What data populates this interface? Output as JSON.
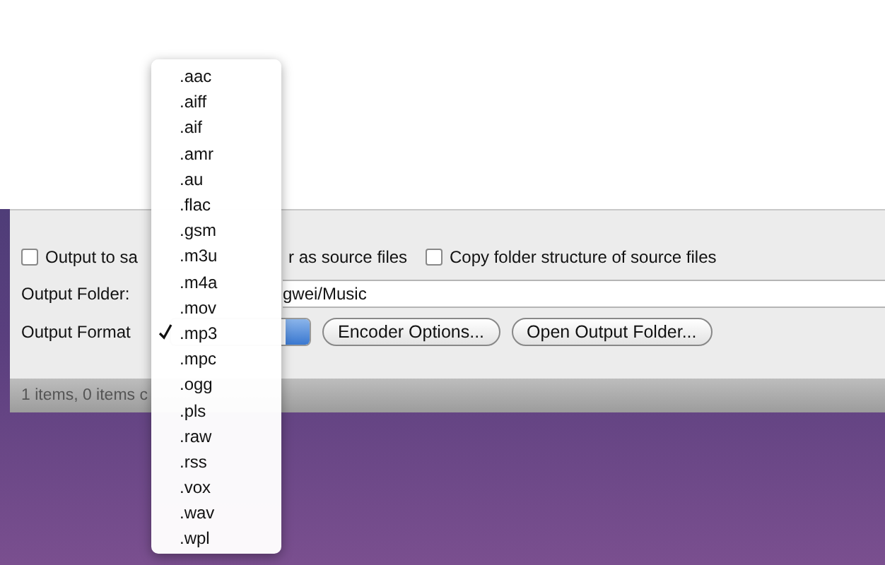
{
  "options": [
    {
      "kind": "checkbox",
      "checked": false,
      "label_parts": [
        "Output to sa",
        "r as source files"
      ]
    },
    {
      "kind": "checkbox",
      "checked": false,
      "label_parts": [
        "Copy folder structure of source files"
      ]
    }
  ],
  "output_folder": {
    "label": "Output Folder:",
    "value": "gwei/Music"
  },
  "output_format": {
    "label": "Output Format"
  },
  "buttons": [
    "Encoder Options...",
    "Open Output Folder..."
  ],
  "status_bar": "1 items, 0 items c",
  "format_menu": {
    "items": [
      {
        "label": ".aac",
        "selected": false
      },
      {
        "label": ".aiff",
        "selected": false
      },
      {
        "label": ".aif",
        "selected": false
      },
      {
        "label": ".amr",
        "selected": false
      },
      {
        "label": ".au",
        "selected": false
      },
      {
        "label": ".flac",
        "selected": false
      },
      {
        "label": ".gsm",
        "selected": false
      },
      {
        "label": ".m3u",
        "selected": false
      },
      {
        "label": ".m4a",
        "selected": false
      },
      {
        "label": ".mov",
        "selected": false
      },
      {
        "label": ".mp3",
        "selected": true
      },
      {
        "label": ".mpc",
        "selected": false
      },
      {
        "label": ".ogg",
        "selected": false
      },
      {
        "label": ".pls",
        "selected": false
      },
      {
        "label": ".raw",
        "selected": false
      },
      {
        "label": ".rss",
        "selected": false
      },
      {
        "label": ".vox",
        "selected": false
      },
      {
        "label": ".wav",
        "selected": false
      },
      {
        "label": ".wpl",
        "selected": false
      }
    ]
  }
}
